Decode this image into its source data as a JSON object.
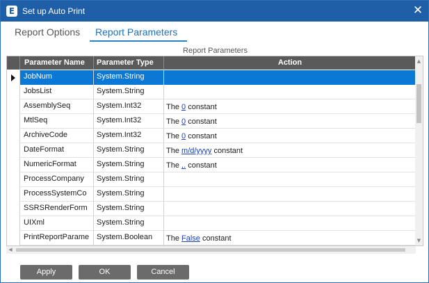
{
  "window": {
    "title": "Set up Auto Print",
    "app_icon": "epicor-e-icon",
    "close_glyph": "✕"
  },
  "tabs": [
    {
      "label": "Report Options",
      "active": false
    },
    {
      "label": "Report Parameters",
      "active": true
    }
  ],
  "grid": {
    "caption": "Report Parameters",
    "columns": {
      "name": "Parameter Name",
      "type": "Parameter Type",
      "action": "Action"
    },
    "rows": [
      {
        "name": "JobNum",
        "type": "System.String",
        "action": null,
        "selected": true
      },
      {
        "name": "JobsList",
        "type": "System.String",
        "action": null
      },
      {
        "name": "AssemblySeq",
        "type": "System.Int32",
        "action": {
          "prefix": "The",
          "value": "0",
          "suffix": "constant"
        }
      },
      {
        "name": "MtlSeq",
        "type": "System.Int32",
        "action": {
          "prefix": "The",
          "value": "0",
          "suffix": "constant"
        }
      },
      {
        "name": "ArchiveCode",
        "type": "System.Int32",
        "action": {
          "prefix": "The",
          "value": "0",
          "suffix": "constant"
        }
      },
      {
        "name": "DateFormat",
        "type": "System.String",
        "action": {
          "prefix": "The",
          "value": "m/d/yyyy",
          "suffix": "constant"
        }
      },
      {
        "name": "NumericFormat",
        "type": "System.String",
        "action": {
          "prefix": "The",
          "value": ",.",
          "suffix": "constant"
        }
      },
      {
        "name": "ProcessCompany",
        "type": "System.String",
        "action": null
      },
      {
        "name": "ProcessSystemCo",
        "type": "System.String",
        "action": null
      },
      {
        "name": "SSRSRenderForm",
        "type": "System.String",
        "action": null
      },
      {
        "name": "UIXml",
        "type": "System.String",
        "action": null
      },
      {
        "name": "PrintReportParame",
        "type": "System.Boolean",
        "action": {
          "prefix": "The",
          "value": "False",
          "suffix": "constant"
        }
      }
    ]
  },
  "buttons": {
    "apply": "Apply",
    "ok": "OK",
    "cancel": "Cancel"
  },
  "colors": {
    "titlebar": "#1e5fa8",
    "accent": "#2a7fc9",
    "selected_row": "#0a78d4",
    "header": "#5a5a5a",
    "button": "#6b6b6b"
  }
}
